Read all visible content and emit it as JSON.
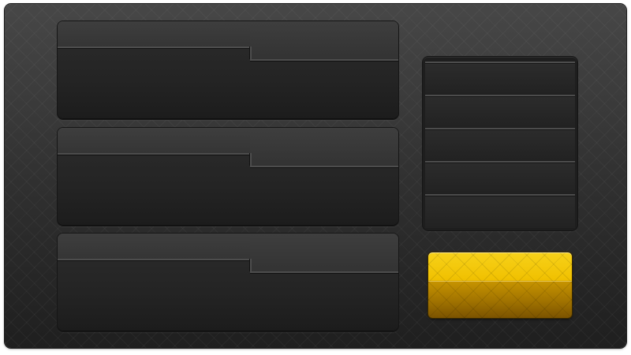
{
  "window": {
    "title": ""
  },
  "panels": [
    {
      "id": "panel-1",
      "header_left": "",
      "header_right": "",
      "body": ""
    },
    {
      "id": "panel-2",
      "header_left": "",
      "header_right": "",
      "body": ""
    },
    {
      "id": "panel-3",
      "header_left": "",
      "header_right": "",
      "body": ""
    }
  ],
  "list": {
    "items": [
      {
        "label": ""
      },
      {
        "label": ""
      },
      {
        "label": ""
      },
      {
        "label": ""
      },
      {
        "label": ""
      }
    ]
  },
  "action_button": {
    "label": ""
  },
  "colors": {
    "background": "#2f2f2f",
    "panel": "#242424",
    "divider": "#4d4d4d",
    "accent": "#f0c000",
    "accent_dark": "#7b5300"
  }
}
